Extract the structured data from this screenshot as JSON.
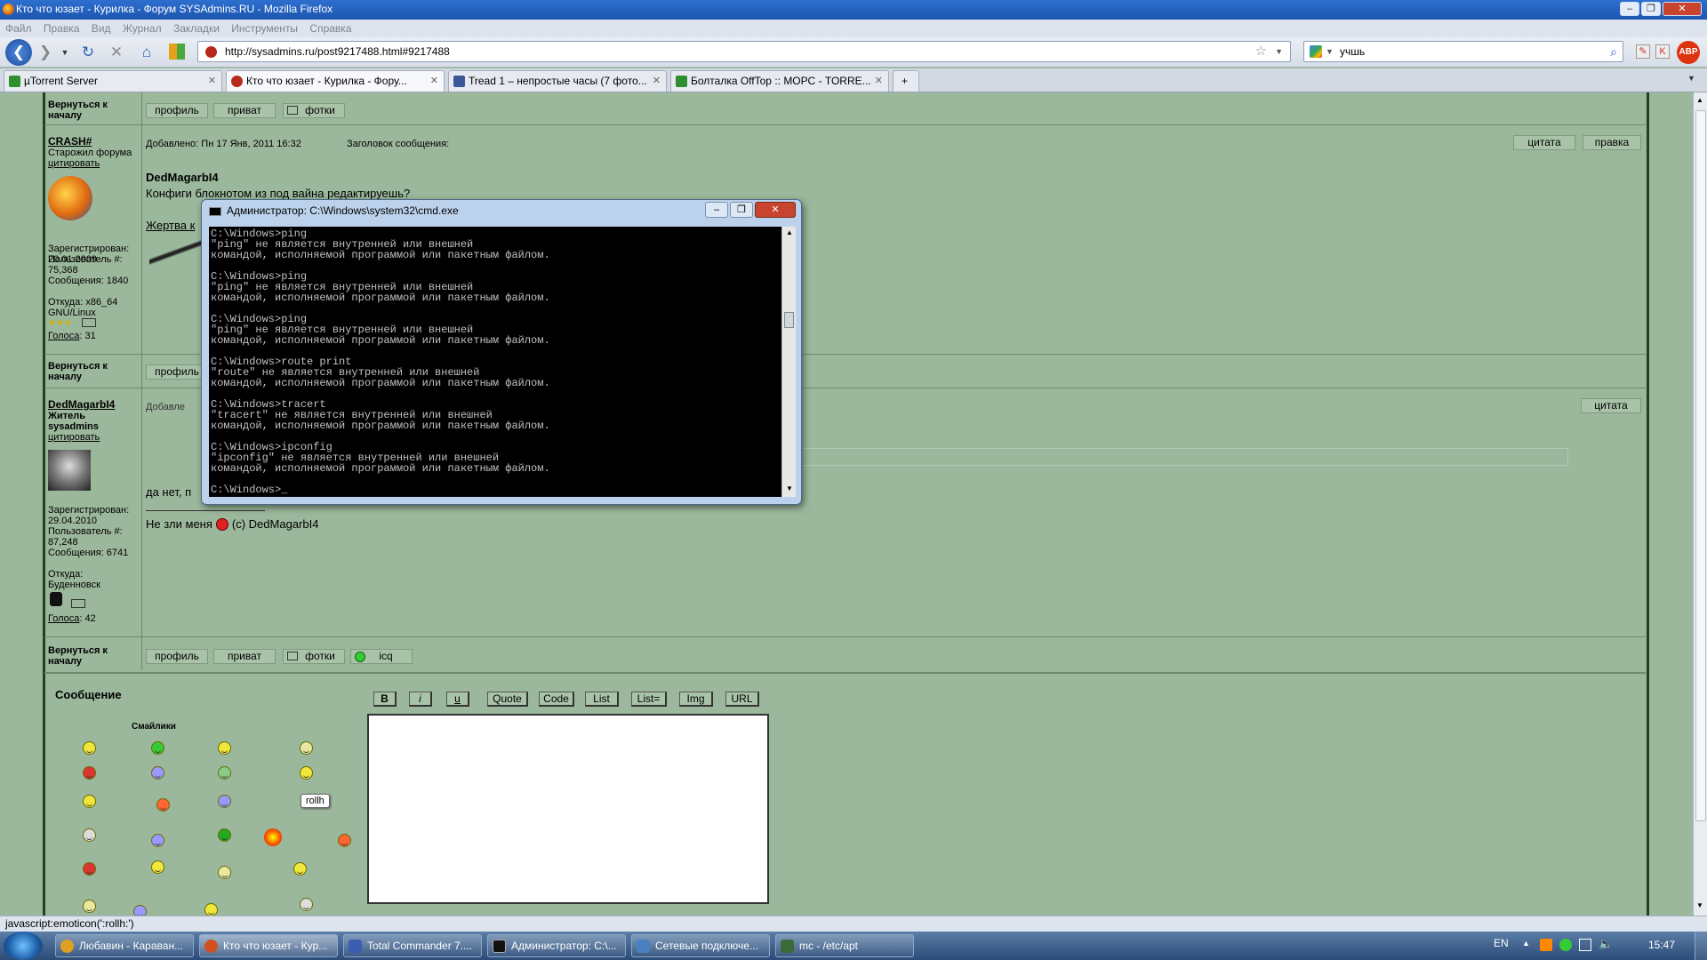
{
  "window": {
    "title": "Кто что юзает - Курилка - Форум SYSAdmins.RU - Mozilla Firefox"
  },
  "menu": [
    "Файл",
    "Правка",
    "Вид",
    "Журнал",
    "Закладки",
    "Инструменты",
    "Справка"
  ],
  "nav": {
    "url": "http://sysadmins.ru/post9217488.html#9217488",
    "search": "учшь"
  },
  "tabs": [
    {
      "label": "µTorrent Server",
      "color": "#2f8f2f"
    },
    {
      "label": "Кто что юзает - Курилка - Фору...",
      "color": "#b52a1a"
    },
    {
      "label": "Tread 1 – непростые часы (7 фото...",
      "color": "#3b5998"
    },
    {
      "label": "Болталка OffTop :: МОРС - TORRE...",
      "color": "#2f8f2f"
    }
  ],
  "forum": {
    "top_back": "Вернуться к началу",
    "profile_btn": "профиль",
    "private_btn": "приват",
    "photos_btn": "фотки",
    "icq_btn": "icq",
    "quote_btn": "цитата",
    "edit_btn": "правка",
    "post1": {
      "author": "CRASH#",
      "rank": "Старожил форума",
      "quote_link": "цитировать",
      "posted": "Добавлено: Пн 17 Янв, 2011 16:32",
      "subject": "Заголовок сообщения:",
      "quoted_name": "DedMagarbI4",
      "text": "Конфиги блокнотом из под вайна редактируешь?",
      "sig": "Жертва к",
      "registered": "Зарегистрирован: 20.01.2009",
      "usernum": "Пользователь #: 75,368",
      "messages": "Сообщения: 1840",
      "from": "Откуда: x86_64 GNU/Linux",
      "votes_label": "Голоса",
      "votes": ": 31"
    },
    "post2": {
      "author": "DedMagarbI4",
      "rank": "Житель sysadmins",
      "quote_link": "цитировать",
      "posted": "Добавле",
      "text": "да нет, п",
      "sig": "Не зли меня",
      "sig_tail": "(c) DedMagarbI4",
      "registered": "Зарегистрирован: 29.04.2010",
      "usernum": "Пользователь #: 87,248",
      "messages": "Сообщения: 6741",
      "from": "Откуда: Буденновск",
      "votes_label": "Голоса",
      "votes": ": 42"
    }
  },
  "editor": {
    "title": "Сообщение",
    "smilies_title": "Смайлики",
    "tooltip": "rollh",
    "buttons": [
      "B",
      "i",
      "u",
      "Quote",
      "Code",
      "List",
      "List=",
      "Img",
      "URL"
    ]
  },
  "cmd": {
    "title": "Администратор: C:\\Windows\\system32\\cmd.exe",
    "output": "C:\\Windows>ping\n\"ping\" не является внутренней или внешней\nкомандой, исполняемой программой или пакетным файлом.\n\nC:\\Windows>ping\n\"ping\" не является внутренней или внешней\nкомандой, исполняемой программой или пакетным файлом.\n\nC:\\Windows>ping\n\"ping\" не является внутренней или внешней\nкомандой, исполняемой программой или пакетным файлом.\n\nC:\\Windows>route print\n\"route\" не является внутренней или внешней\nкомандой, исполняемой программой или пакетным файлом.\n\nC:\\Windows>tracert\n\"tracert\" не является внутренней или внешней\nкомандой, исполняемой программой или пакетным файлом.\n\nC:\\Windows>ipconfig\n\"ipconfig\" не является внутренней или внешней\nкомандой, исполняемой программой или пакетным файлом.\n\nC:\\Windows>_"
  },
  "status": {
    "text": "javascript:emoticon(':rollh:')"
  },
  "taskbar": {
    "items": [
      {
        "label": "Любавин - Караван...",
        "color": "#e0a020"
      },
      {
        "label": "Кто что юзает - Кур...",
        "color": "#d05020"
      },
      {
        "label": "Total Commander 7....",
        "color": "#3b5fb0"
      },
      {
        "label": "Администратор: C:\\...",
        "color": "#111111"
      },
      {
        "label": "Сетевые подключе...",
        "color": "#4a7fc0"
      },
      {
        "label": "mc - /etc/apt",
        "color": "#3a6a3a"
      }
    ],
    "lang": "EN",
    "clock": "15:47"
  }
}
